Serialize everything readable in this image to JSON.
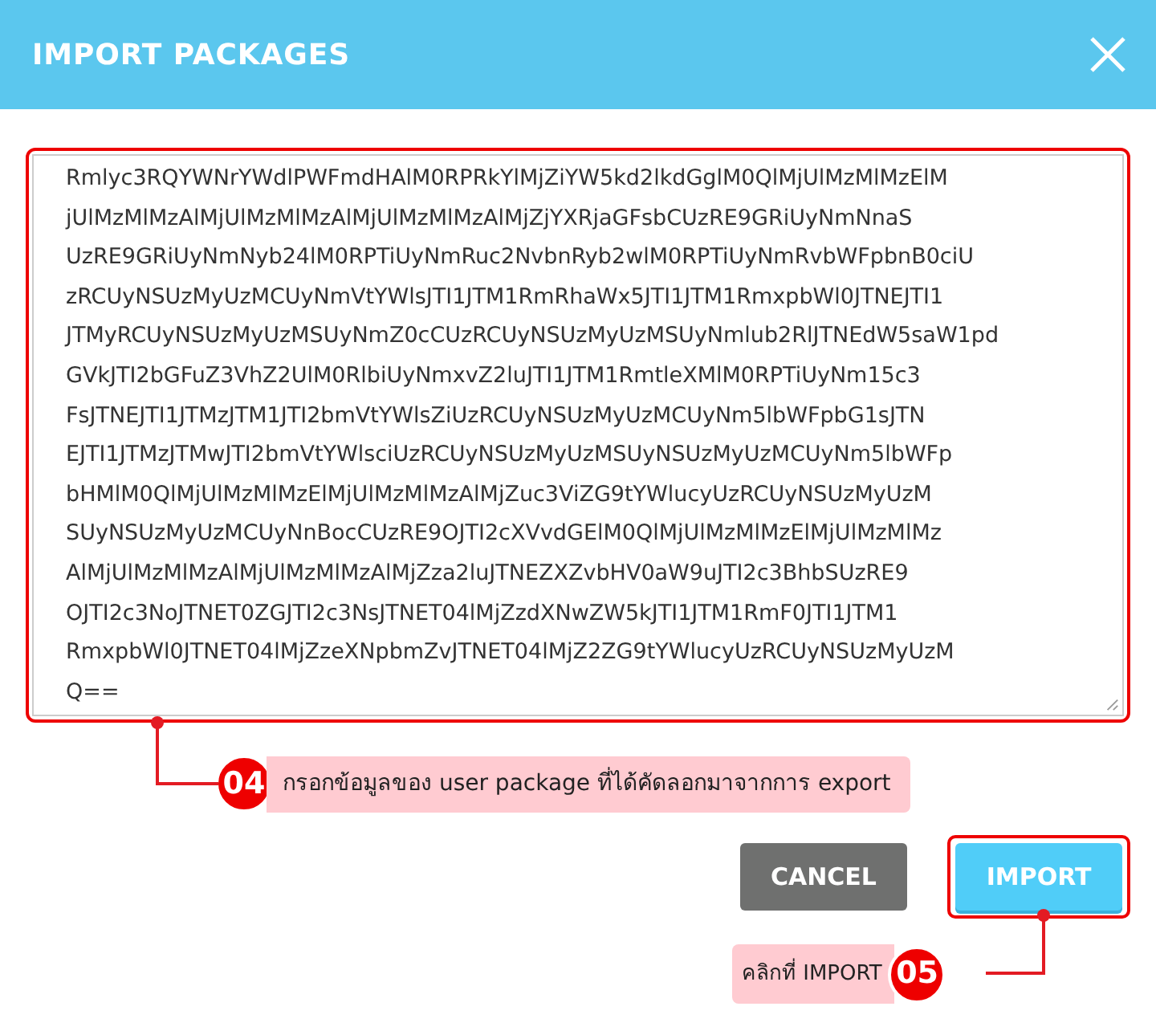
{
  "dialog": {
    "title": "IMPORT PACKAGES"
  },
  "textarea": {
    "highlighted": true,
    "lines": [
      "Rmlyc3RQYWNrYWdlPWFmdHAlM0RPRkYlMjZiYW5kd2lkdGglM0QlMjUlMzMlMzElM",
      "jUlMzMlMzAlMjUlMzMlMzAlMjUlMzMlMzAlMjZjYXRjaGFsbCUzRE9GRiUyNmNnaS",
      "UzRE9GRiUyNmNyb24lM0RPTiUyNmRuc2NvbnRyb2wlM0RPTiUyNmRvbWFpbnB0ciU",
      "zRCUyNSUzMyUzMCUyNmVtYWlsJTI1JTM1RmRhaWx5JTI1JTM1RmxpbWl0JTNEJTI1",
      "JTMyRCUyNSUzMyUzMSUyNmZ0cCUzRCUyNSUzMyUzMSUyNmlub2RlJTNEdW5saW1pd",
      "GVkJTI2bGFuZ3VhZ2UlM0RlbiUyNmxvZ2luJTI1JTM1RmtleXMlM0RPTiUyNm15c3",
      "FsJTNEJTI1JTMzJTM1JTI2bmVtYWlsZiUzRCUyNSUzMyUzMCUyNm5lbWFpbG1sJTN",
      "EJTI1JTMzJTMwJTI2bmVtYWlsciUzRCUyNSUzMyUzMSUyNSUzMyUzMCUyNm5lbWFp",
      "bHMlM0QlMjUlMzMlMzElMjUlMzMlMzAlMjZuc3ViZG9tYWlucyUzRCUyNSUzMyUzM",
      "SUyNSUzMyUzMCUyNnBocCUzRE9OJTI2cXVvdGElM0QlMjUlMzMlMzElMjUlMzMlMz",
      "AlMjUlMzMlMzAlMjUlMzMlMzAlMjZza2luJTNEZXZvbHV0aW9uJTI2c3BhbSUzRE9",
      "OJTI2c3NoJTNET0ZGJTI2c3NsJTNET04lMjZzdXNwZW5kJTI1JTM1RmF0JTI1JTM1",
      "RmxpbWl0JTNET04lMjZzeXNpbmZvJTNET04lMjZ2ZG9tYWlucyUzRCUyNSUzMyUzM",
      "Q=="
    ]
  },
  "annotations": [
    {
      "number": "04",
      "text": "กรอกข้อมูลของ user package ที่ได้คัดลอกมาจากการ export"
    },
    {
      "number": "05",
      "text": "คลิกที่ IMPORT"
    }
  ],
  "buttons": [
    {
      "label": "CANCEL",
      "kind": "secondary",
      "highlighted": false
    },
    {
      "label": "IMPORT",
      "kind": "primary",
      "highlighted": true
    }
  ]
}
